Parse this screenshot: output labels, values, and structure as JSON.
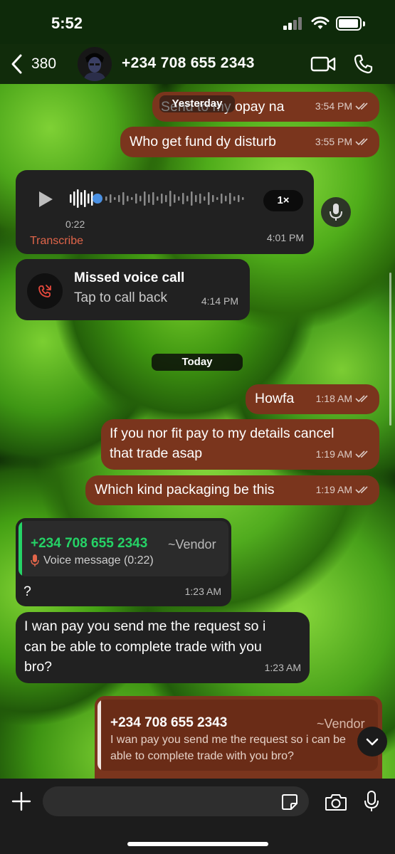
{
  "status_bar": {
    "time": "5:52"
  },
  "header": {
    "back_count": "380",
    "contact_name": "+234 708 655 2343"
  },
  "messages": {
    "m1": {
      "text": "Send to my opay na",
      "time": "3:54 PM"
    },
    "date_yesterday": "Yesterday",
    "m2": {
      "text": "Who get fund dy disturb",
      "time": "3:55 PM"
    },
    "voice": {
      "duration": "0:22",
      "speed": "1×",
      "transcribe": "Transcribe",
      "time": "4:01 PM"
    },
    "missed_call": {
      "title": "Missed voice call",
      "subtitle": "Tap to call back",
      "time": "4:14 PM"
    },
    "date_today": "Today",
    "m3": {
      "text": "Howfa",
      "time": "1:18 AM"
    },
    "m4": {
      "line1": "If you nor fit pay to my details cancel",
      "line2": "that trade asap",
      "time": "1:19 AM"
    },
    "m5": {
      "text": "Which kind packaging be this",
      "time": "1:19 AM"
    },
    "m6": {
      "quote_name": "+234 708 655 2343",
      "quote_tag": "~Vendor",
      "quote_text": "Voice message (0:22)",
      "text": "?",
      "time": "1:23 AM"
    },
    "m7": {
      "line1": "I wan pay you send me the request so i",
      "line2": "can be able to complete trade with you",
      "line3": "bro?",
      "time": "1:23 AM"
    },
    "m8": {
      "quote_name": "+234 708 655 2343",
      "quote_tag": "~Vendor",
      "quote_line1": "I wan pay you send me the request so i can be",
      "quote_line2": "able to complete trade with you bro?"
    }
  },
  "composer": {
    "placeholder": ""
  },
  "colors": {
    "outgoing_bubble": "#7a351d",
    "incoming_bubble": "#212121",
    "quote_accent_green": "#25d366",
    "transcribe_orange": "#e0654a",
    "voice_progress_blue": "#4a90e2"
  },
  "icons": [
    "back-chevron-icon",
    "video-camera-icon",
    "phone-icon",
    "play-icon",
    "microphone-icon",
    "missed-call-icon",
    "plus-icon",
    "sticker-icon",
    "camera-icon",
    "chevron-down-icon",
    "wifi-icon",
    "battery-icon",
    "signal-icon"
  ]
}
